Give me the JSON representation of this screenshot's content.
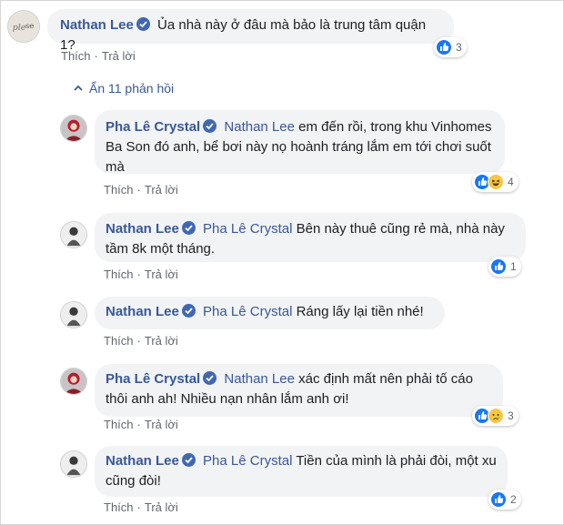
{
  "colors": {
    "link": "#385898",
    "bubble": "#f2f3f5",
    "like": "#1877f2",
    "verified": "#4267b2"
  },
  "actions": {
    "like": "Thích",
    "reply": "Trả lời",
    "separator": "·"
  },
  "hide_replies": "Ẩn 11 phản hồi",
  "comments": [
    {
      "author": "Nathan Lee",
      "text": "Ủa nhà này ở đâu mà bảo là trung tâm quận 1?",
      "reactions": [
        "like"
      ],
      "count": "3"
    },
    {
      "author": "Pha Lê Crystal",
      "mention": "Nathan Lee",
      "text": "em đến rồi, trong khu Vinhomes Ba Son đó anh, bể bơi này nọ hoành tráng lắm em tới chơi suốt mà",
      "reactions": [
        "like",
        "haha"
      ],
      "count": "4"
    },
    {
      "author": "Nathan Lee",
      "mention": "Pha Lê Crystal",
      "text": "Bên này thuê cũng rẻ mà, nhà này tầm 8k một tháng.",
      "reactions": [
        "like"
      ],
      "count": "1"
    },
    {
      "author": "Nathan Lee",
      "mention": "Pha Lê Crystal",
      "text": "Ráng lấy lại tiền nhé!",
      "reactions": [],
      "count": ""
    },
    {
      "author": "Pha Lê Crystal",
      "mention": "Nathan Lee",
      "text": "xác định mất nên phải tố cáo thôi anh ah! Nhiều nạn nhân lắm anh ơi!",
      "reactions": [
        "like",
        "sad"
      ],
      "count": "3"
    },
    {
      "author": "Nathan Lee",
      "mention": "Pha Lê Crystal",
      "text": "Tiền của mình là phải đòi, một xu cũng đòi!",
      "reactions": [
        "like"
      ],
      "count": "2"
    }
  ]
}
